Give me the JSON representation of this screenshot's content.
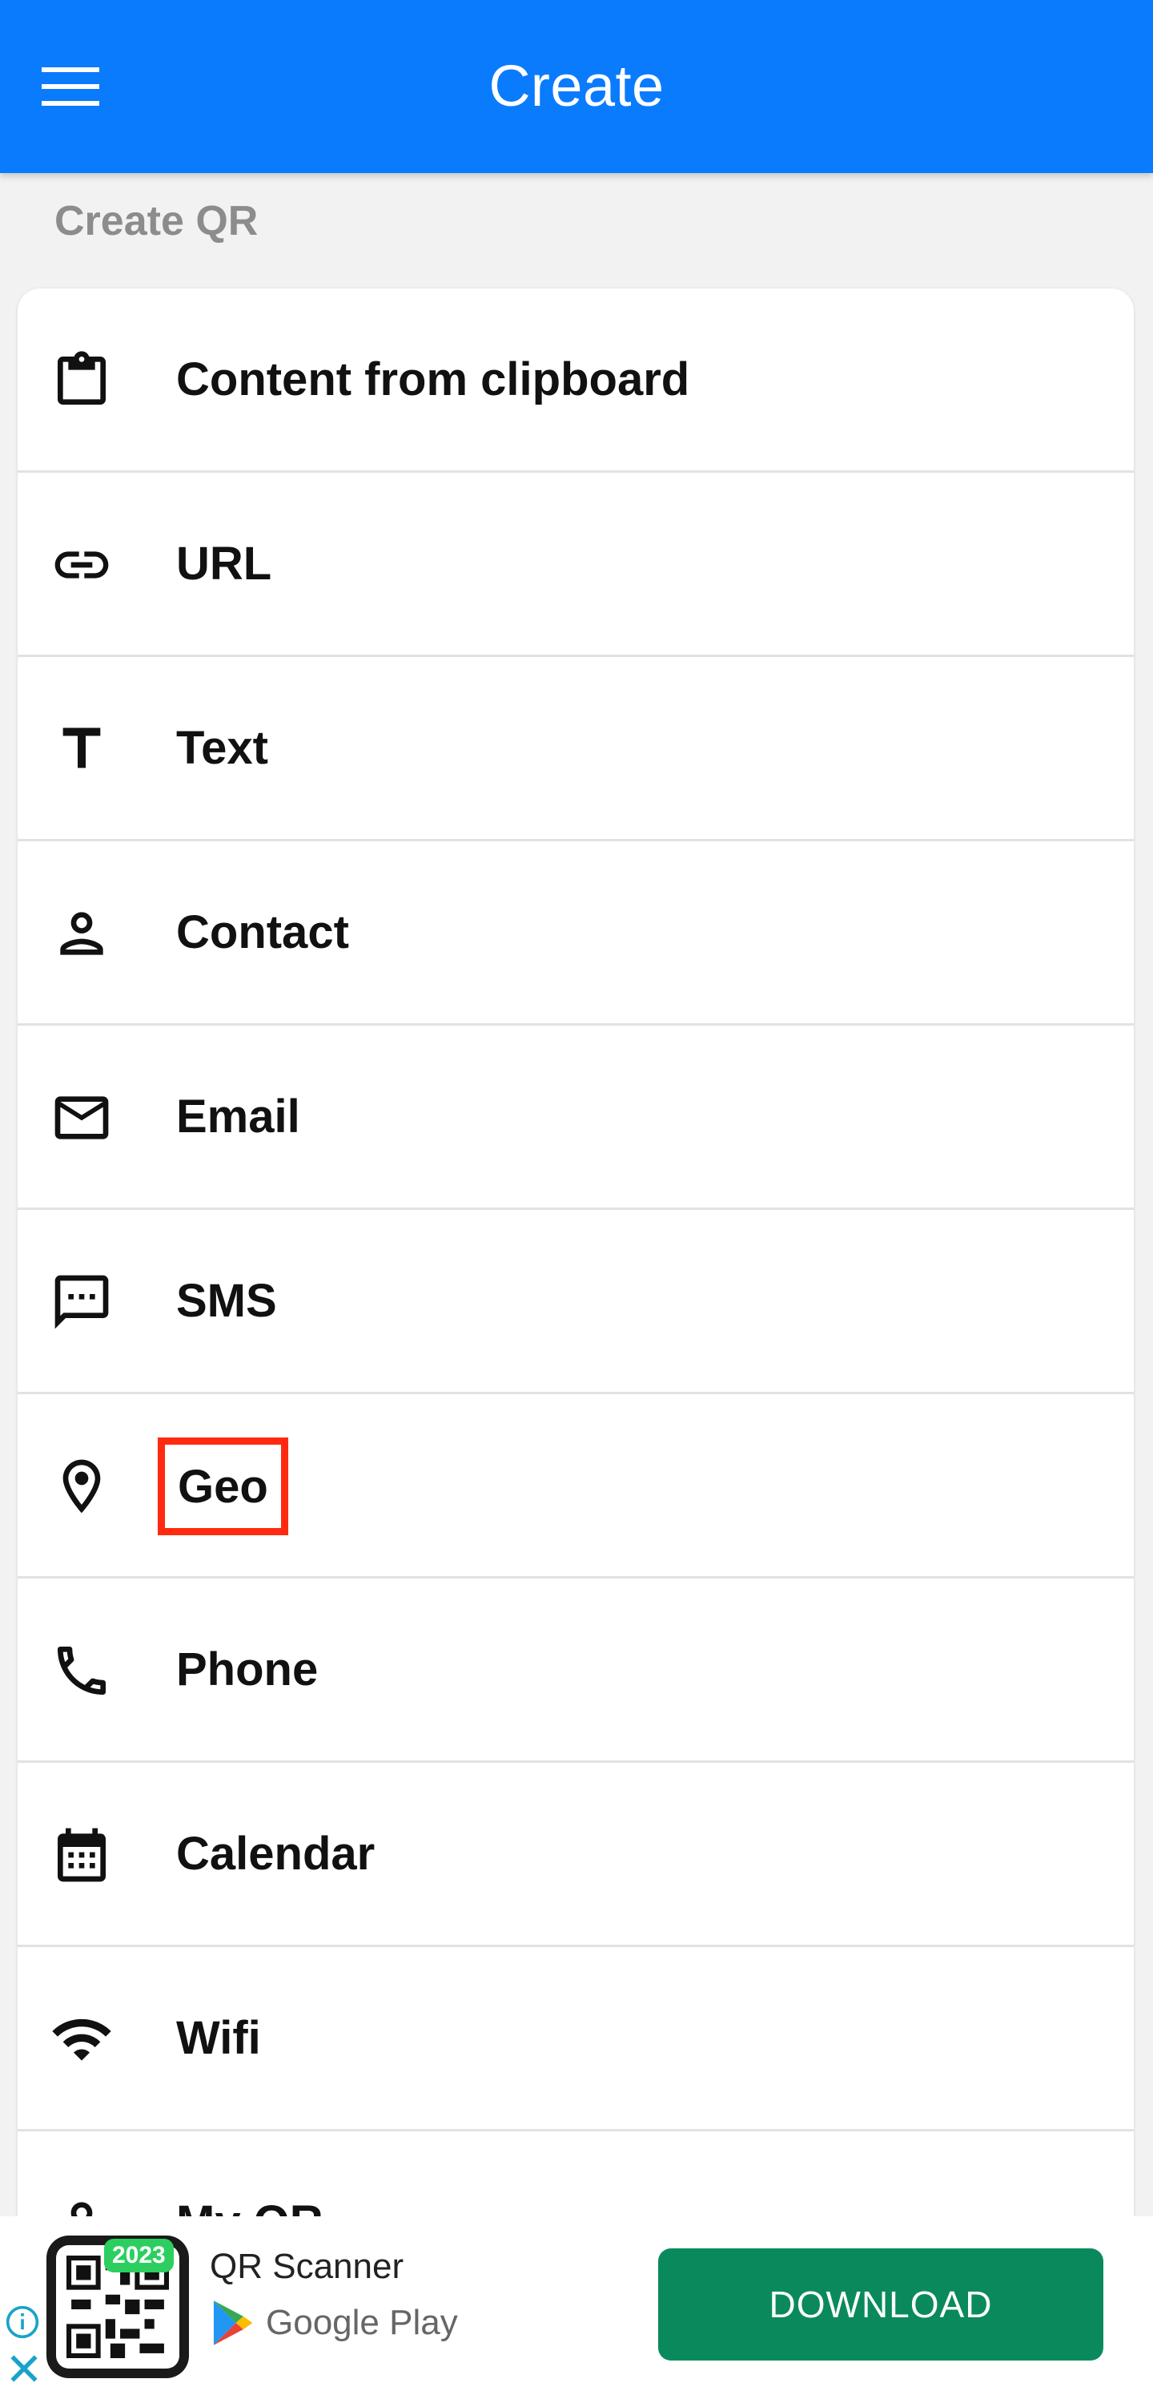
{
  "appbar": {
    "title": "Create",
    "menu_icon": "hamburger-menu-icon"
  },
  "section": {
    "label": "Create QR"
  },
  "items": [
    {
      "label": "Content from clipboard",
      "icon": "clipboard-icon"
    },
    {
      "label": "URL",
      "icon": "link-icon"
    },
    {
      "label": "Text",
      "icon": "text-icon"
    },
    {
      "label": "Contact",
      "icon": "person-icon"
    },
    {
      "label": "Email",
      "icon": "envelope-icon"
    },
    {
      "label": "SMS",
      "icon": "message-icon"
    },
    {
      "label": "Geo",
      "icon": "location-pin-icon",
      "highlighted": true
    },
    {
      "label": "Phone",
      "icon": "phone-icon"
    },
    {
      "label": "Calendar",
      "icon": "calendar-icon"
    },
    {
      "label": "Wifi",
      "icon": "wifi-icon"
    },
    {
      "label": "My QR",
      "icon": "person-icon"
    }
  ],
  "ad": {
    "app_name": "QR Scanner",
    "store": "Google Play",
    "badge": "2023",
    "button_label": "DOWNLOAD",
    "info_icon": "info-icon",
    "close_icon": "close-icon"
  },
  "colors": {
    "appbar": "#0a7bfd",
    "highlight": "#ff2a0f",
    "download_button": "#0a8a5c",
    "badge": "#2ccf5f"
  }
}
